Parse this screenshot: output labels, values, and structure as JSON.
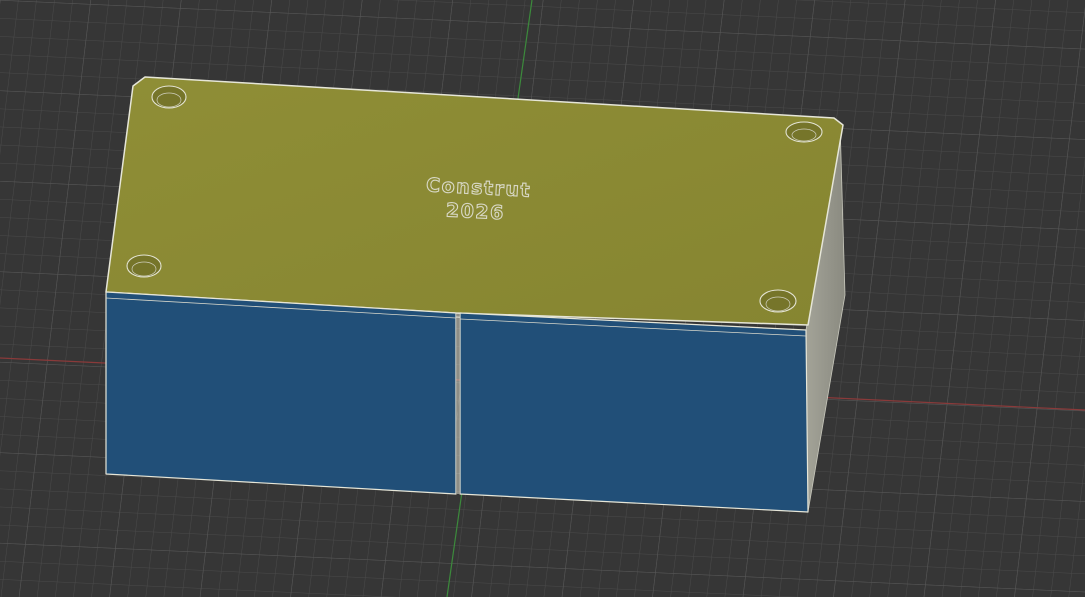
{
  "model": {
    "engraving": {
      "line1": "Construt",
      "line2": "2026"
    },
    "colors": {
      "background": "#363636",
      "grid_minor": "#4a4a4a",
      "grid_major": "#575757",
      "axis_x": "#8a3a3a",
      "axis_y": "#3c8a3c",
      "top_face": "#8c8b33",
      "front_faces": "#214f78",
      "side_face": "#8a8a82",
      "edge_highlight": "#e6e6d8"
    },
    "front_panels": [
      "left",
      "right"
    ],
    "mounting_holes": 4
  }
}
